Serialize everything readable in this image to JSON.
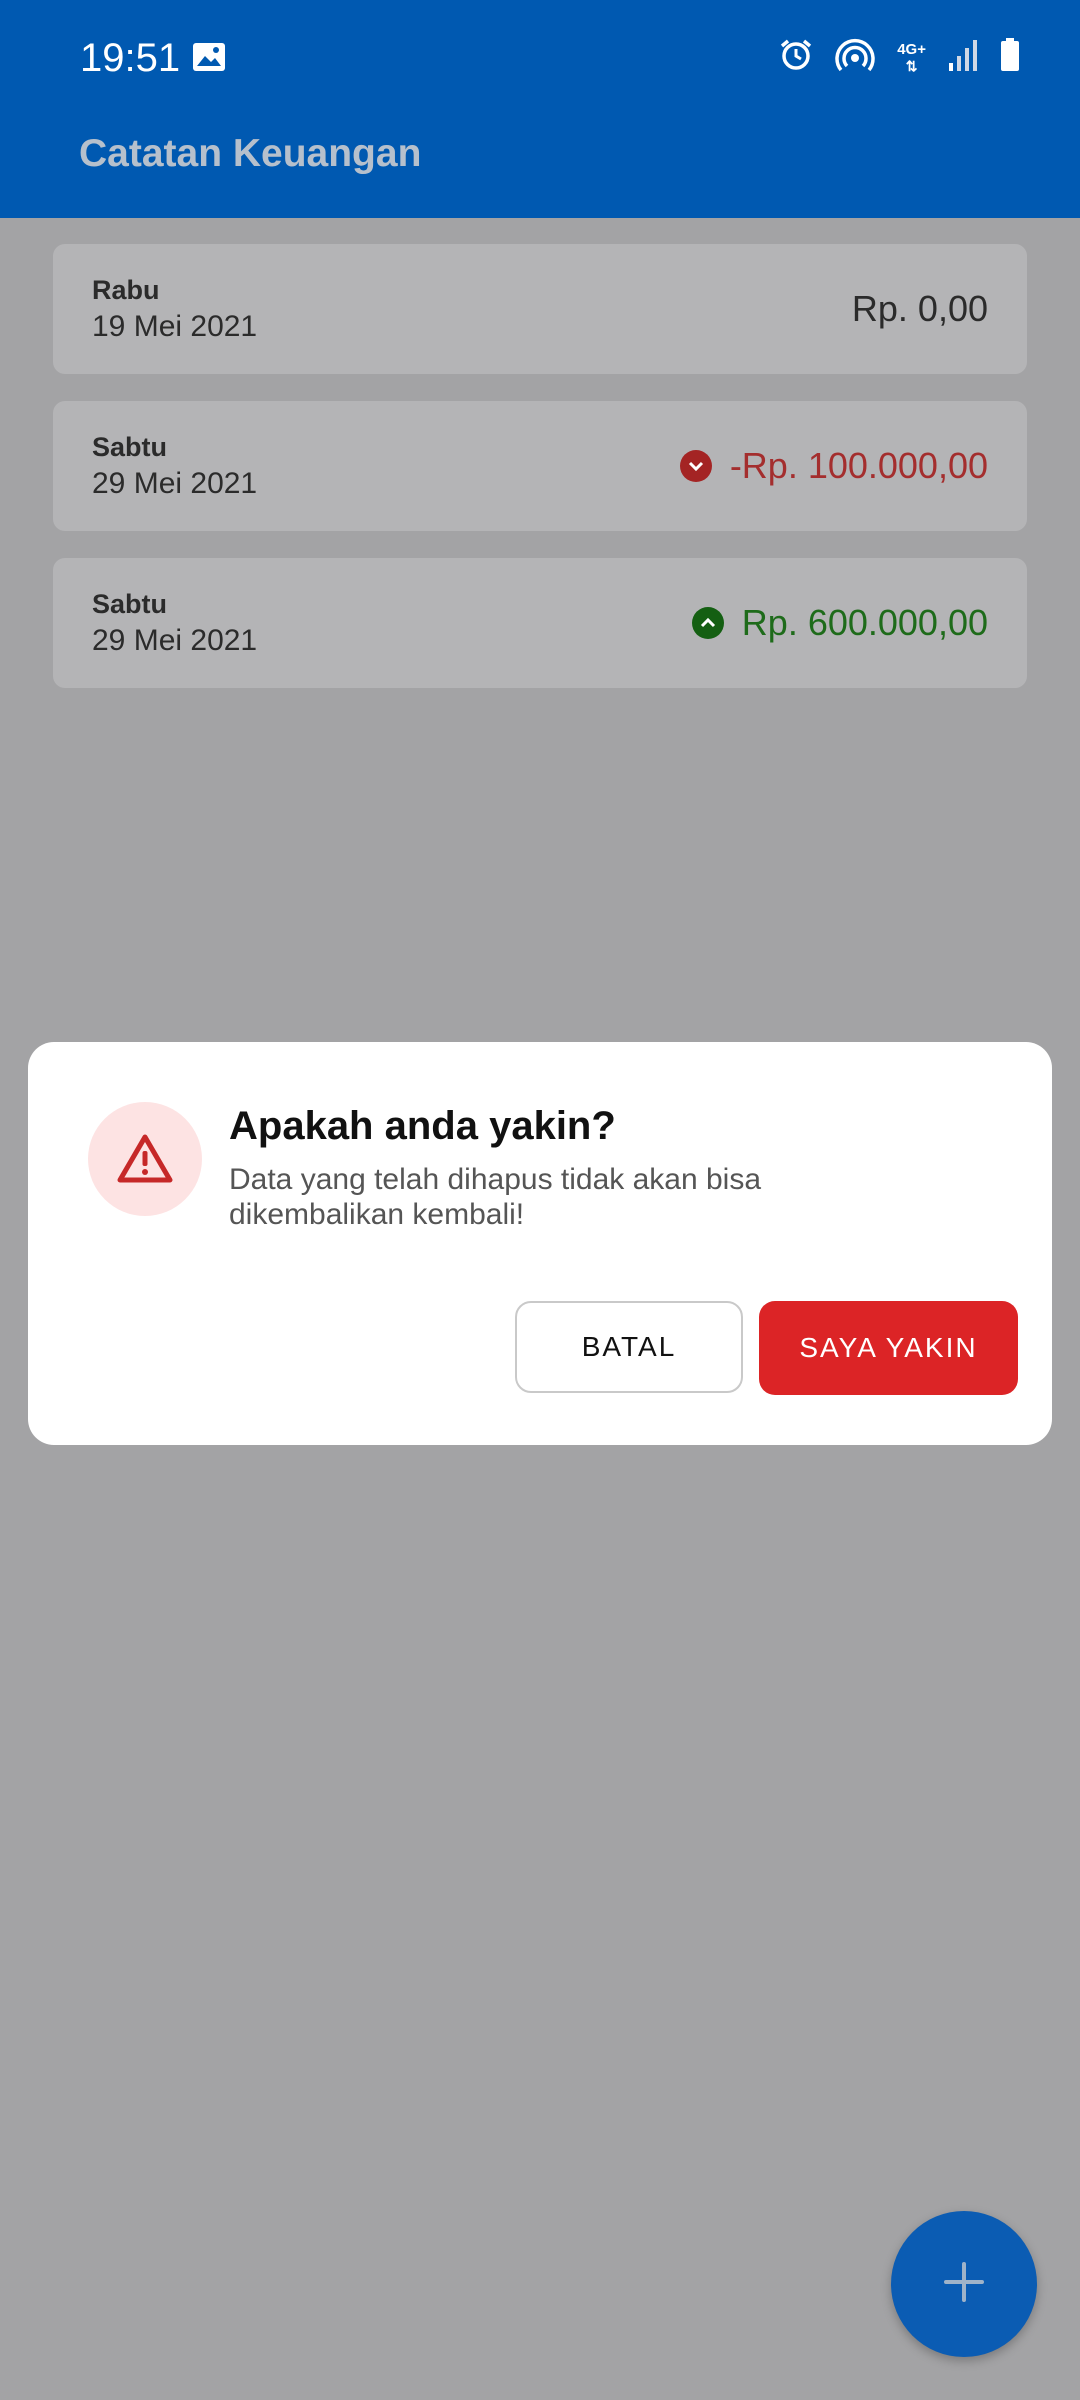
{
  "status_bar": {
    "time": "19:51",
    "network_label": "4G+",
    "icons": [
      "gallery-icon",
      "alarm-icon",
      "hotspot-icon",
      "network-4g-icon",
      "signal-icon",
      "battery-icon"
    ]
  },
  "app_bar": {
    "title": "Catatan Keuangan"
  },
  "records": [
    {
      "day": "Rabu",
      "date": "19 Mei 2021",
      "amount": "Rp. 0,00",
      "direction": "neutral"
    },
    {
      "day": "Sabtu",
      "date": "29 Mei 2021",
      "amount": "-Rp. 100.000,00",
      "direction": "down"
    },
    {
      "day": "Sabtu",
      "date": "29 Mei 2021",
      "amount": "Rp. 600.000,00",
      "direction": "up"
    }
  ],
  "dialog": {
    "icon": "warning-icon",
    "title": "Apakah anda yakin?",
    "message": "Data yang telah dihapus tidak akan bisa dikembalikan kembali!",
    "cancel_label": "BATAL",
    "confirm_label": "SAYA YAKIN"
  },
  "fab": {
    "icon": "plus-icon"
  },
  "colors": {
    "primary": "#0059b1",
    "danger": "#dc2426",
    "negative_amount": "#a42e2e",
    "positive_amount": "#1e6b1a",
    "scrim": "#a3a3a5"
  }
}
